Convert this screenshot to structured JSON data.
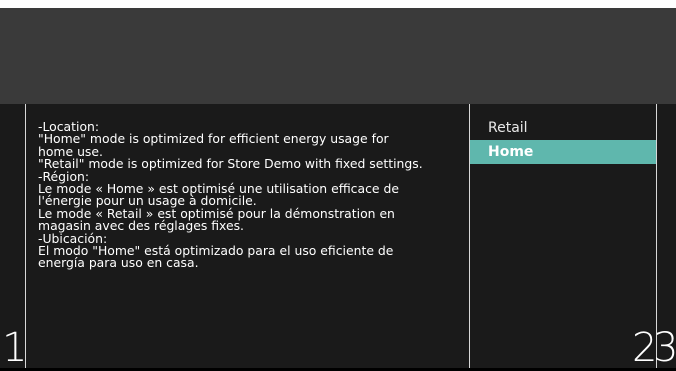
{
  "info": {
    "text": "-Location:\n\"Home\" mode is optimized for efficient energy usage for\nhome use.\n\"Retail\" mode is optimized for Store Demo with fixed settings.\n-Région:\nLe mode « Home » est optimisé une utilisation efficace de\nl'énergie pour un usage à domicile.\nLe mode « Retail » est optimisé pour la démonstration en\nmagasin avec des réglages fixes.\n-Ubicación:\nEl modo \"Home\" está optimizado para el uso eficiente de\nenergía para uso en casa."
  },
  "menu": {
    "items": [
      {
        "label": "Retail",
        "selected": false
      },
      {
        "label": "Home",
        "selected": true
      }
    ]
  },
  "columns": {
    "left_number": "1",
    "right_number_a": "2",
    "right_number_b": "3"
  },
  "colors": {
    "highlight": "#5fb7ad",
    "background": "#1a1a1a",
    "header": "#3a3a3a"
  }
}
